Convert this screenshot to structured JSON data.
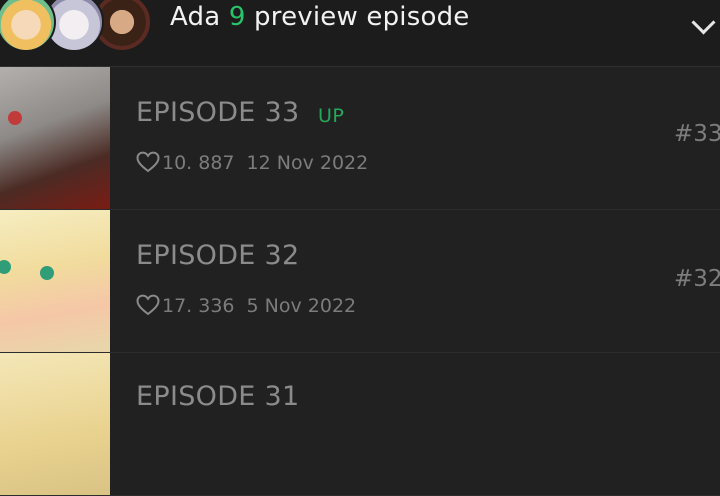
{
  "header": {
    "prefix": "Ada ",
    "count": "9",
    "suffix": " preview episode"
  },
  "episodes": [
    {
      "title": "EPISODE 33",
      "badge": "UP",
      "likes": "10. 887",
      "date": "12 Nov 2022",
      "number": "#33"
    },
    {
      "title": "EPISODE 32",
      "badge": "",
      "likes": "17. 336",
      "date": "5 Nov 2022",
      "number": "#32"
    },
    {
      "title": "EPISODE 31",
      "badge": "",
      "likes": "",
      "date": "",
      "number": ""
    }
  ],
  "colors": {
    "accent_green": "#27c46a",
    "background": "#1b1b1b",
    "row_background": "#212121"
  },
  "icons": {
    "header": "chevron-down-icon",
    "likes": "heart-icon"
  }
}
